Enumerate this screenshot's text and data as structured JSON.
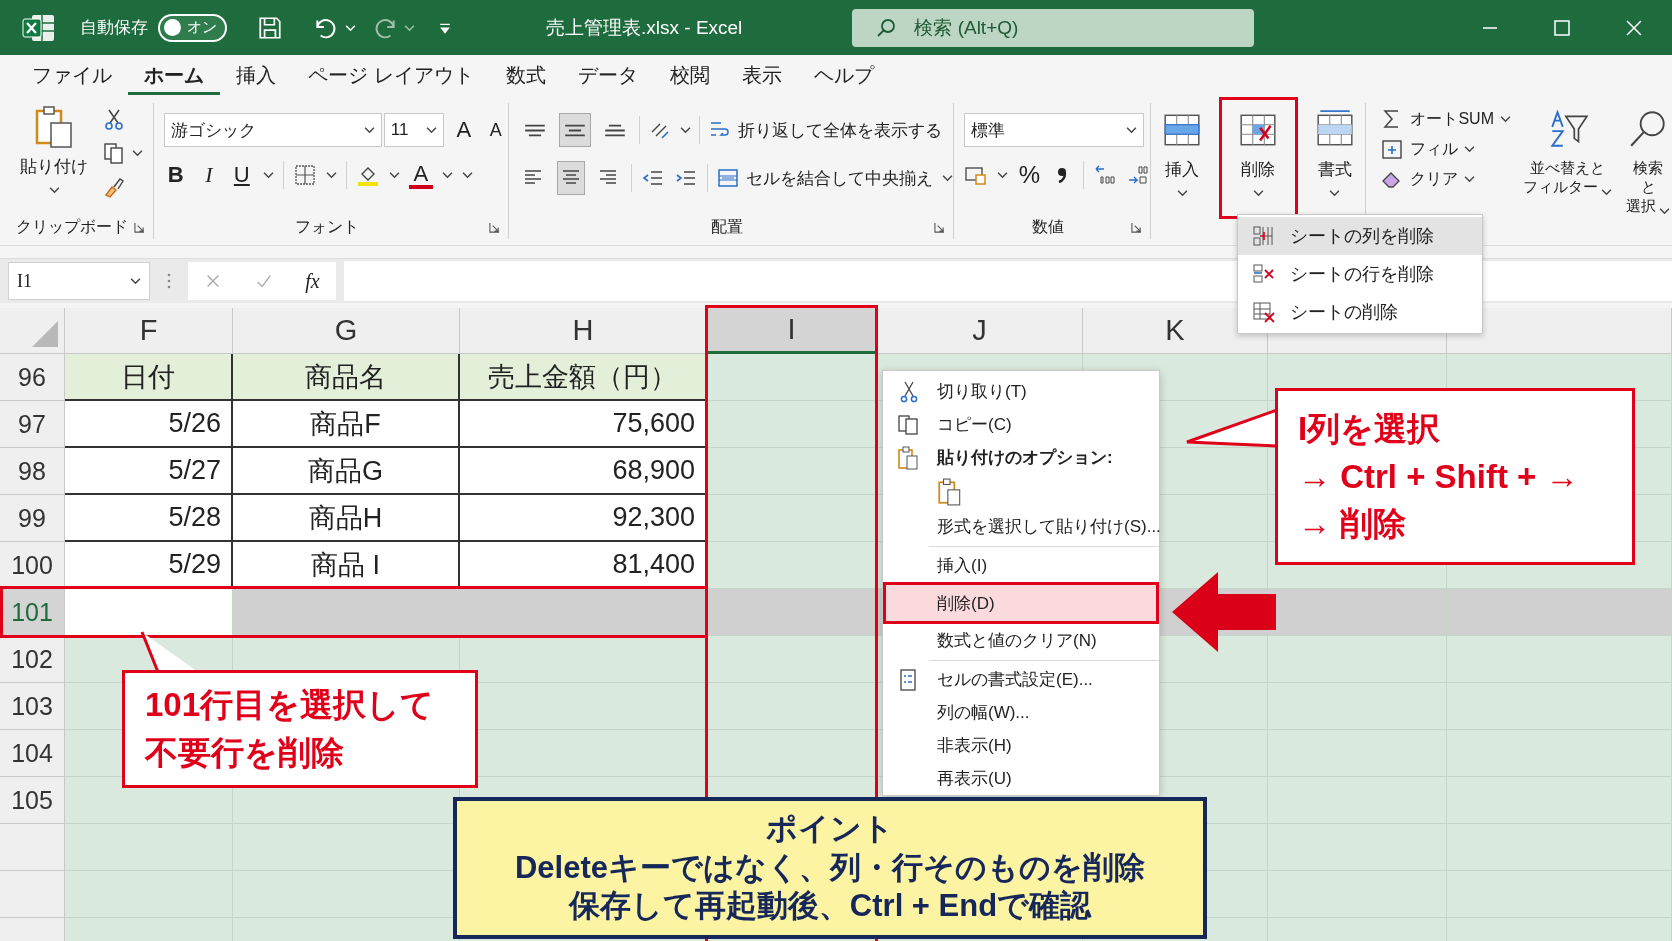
{
  "window": {
    "autosave_label": "自動保存",
    "autosave": {
      "label": "オン",
      "on": true
    },
    "title": "売上管理表.xlsx - Excel",
    "search_placeholder": "検索 (Alt+Q)"
  },
  "tabs": [
    {
      "label": "ファイル",
      "selected": false
    },
    {
      "label": "ホーム",
      "selected": true
    },
    {
      "label": "挿入",
      "selected": false
    },
    {
      "label": "ページ レイアウト",
      "selected": false
    },
    {
      "label": "数式",
      "selected": false
    },
    {
      "label": "データ",
      "selected": false
    },
    {
      "label": "校閲",
      "selected": false
    },
    {
      "label": "表示",
      "selected": false
    },
    {
      "label": "ヘルプ",
      "selected": false
    }
  ],
  "ribbon": {
    "clipboard": {
      "paste": "貼り付け",
      "label": "クリップボード"
    },
    "font": {
      "name": "游ゴシック",
      "size": "11",
      "grow": "A",
      "shrink": "A",
      "styles": [
        "B",
        "I",
        "U"
      ],
      "font_color": "A",
      "label": "フォント"
    },
    "alignment": {
      "vertical": [
        {
          "selected": false
        },
        {
          "selected": true
        },
        {
          "selected": false
        }
      ],
      "horizontal": [
        {
          "selected": false
        },
        {
          "selected": true
        },
        {
          "selected": false
        }
      ],
      "wrap": "折り返して全体を表示する",
      "merge": "セルを結合して中央揃え",
      "label": "配置"
    },
    "number": {
      "format": "標準",
      "percent": "%",
      "label": "数値"
    },
    "cells": [
      {
        "label": "挿入",
        "kind": "insert",
        "selected": false
      },
      {
        "label": "削除",
        "kind": "delete",
        "selected": true
      },
      {
        "label": "書式",
        "kind": "format",
        "selected": false
      }
    ],
    "editing": {
      "autosum": "オートSUM",
      "fill": "フィル",
      "clear": "クリア",
      "sort": [
        "並べ替えと",
        "フィルター"
      ],
      "find": [
        "検索と",
        "選択"
      ]
    }
  },
  "delete_menu": [
    {
      "label": "シートの列を削除",
      "kind": "column",
      "selected": true
    },
    {
      "label": "シートの行を削除",
      "kind": "row",
      "selected": false
    },
    {
      "label": "シートの削除",
      "kind": "sheet",
      "selected": false
    }
  ],
  "formula_bar": {
    "name_box": "I1",
    "fx": "fx"
  },
  "sheet": {
    "columns": [
      {
        "label": "F",
        "selected": false
      },
      {
        "label": "G",
        "selected": false
      },
      {
        "label": "H",
        "selected": false
      },
      {
        "label": "I",
        "selected": true
      },
      {
        "label": "J",
        "selected": false
      },
      {
        "label": "K",
        "selected": false
      },
      {
        "selected": false
      },
      {
        "selected": false
      }
    ],
    "rows": [
      {
        "number": "96",
        "kind": "header",
        "selected": false,
        "cells": [
          "日付",
          "商品名",
          "売上金額（円）"
        ]
      },
      {
        "number": "97",
        "kind": "data",
        "selected": false,
        "cells": [
          "5/26",
          "商品F",
          "75,600"
        ]
      },
      {
        "number": "98",
        "kind": "data",
        "selected": false,
        "cells": [
          "5/27",
          "商品G",
          "68,900"
        ]
      },
      {
        "number": "99",
        "kind": "data",
        "selected": false,
        "cells": [
          "5/28",
          "商品H",
          "92,300"
        ]
      },
      {
        "number": "100",
        "kind": "data",
        "selected": false,
        "cells": [
          "5/29",
          "商品 I",
          "81,400"
        ]
      },
      {
        "number": "101",
        "selected": true
      },
      {
        "number": "102",
        "selected": false
      },
      {
        "number": "103",
        "selected": false
      },
      {
        "number": "104",
        "selected": false
      },
      {
        "number": "105",
        "selected": false
      }
    ]
  },
  "context_menu": [
    {
      "label": "切り取り(T)",
      "kind": "cut",
      "selected": false
    },
    {
      "label": "コピー(C)",
      "kind": "copy",
      "selected": false
    },
    {
      "label": "貼り付けのオプション:",
      "kind": "paste_header"
    },
    {
      "kind": "paste_button"
    },
    {
      "label": "形式を選択して貼り付け(S)...",
      "kind": "plain",
      "selected": false
    },
    {
      "kind": "separator"
    },
    {
      "label": "挿入(I)",
      "kind": "plain",
      "selected": false
    },
    {
      "label": "削除(D)",
      "kind": "plain",
      "selected": true
    },
    {
      "label": "数式と値のクリア(N)",
      "kind": "plain",
      "selected": false
    },
    {
      "kind": "separator"
    },
    {
      "label": "セルの書式設定(E)...",
      "kind": "format_cells",
      "selected": false
    },
    {
      "label": "列の幅(W)...",
      "kind": "plain",
      "selected": false
    },
    {
      "label": "非表示(H)",
      "kind": "plain",
      "selected": false
    },
    {
      "label": "再表示(U)",
      "kind": "plain",
      "selected": false
    }
  ],
  "notes": {
    "row_note": [
      "101行目を選択して",
      "不要行を削除"
    ],
    "column_note": [
      "I列を選択",
      "→ Ctrl + Shift + →",
      "→ 削除"
    ],
    "point": {
      "title": "ポイント",
      "lines": [
        "Deleteキーではなく、列・行そのものを削除",
        "保存して再起動後、Ctrl + Endで確認"
      ]
    }
  }
}
